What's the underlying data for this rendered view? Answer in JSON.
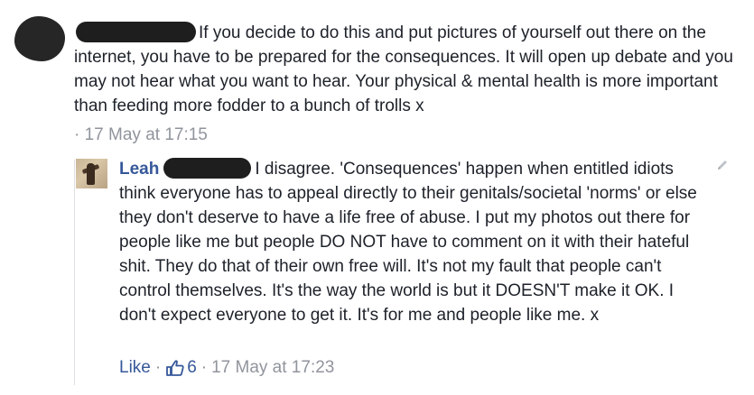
{
  "main_comment": {
    "text": "If you decide to do this and put pictures of yourself out there on the internet, you have to be prepared for the consequences. It will open up debate and you may not hear what you want to hear. Your physical & mental health is more important than feeding more fodder to a bunch of trolls x",
    "separator": "·",
    "timestamp": "17 May at 17:15"
  },
  "reply": {
    "author_first_name": "Leah",
    "text": "I disagree. 'Consequences' happen when entitled idiots think everyone has to appeal directly to their genitals/societal 'norms' or else they don't deserve to have a life free of abuse. I put my photos out there for people like me but people DO NOT have to comment on it with their hateful shit. They do that of their own free will. It's not my fault that people can't control themselves. It's the way the world is but it DOESN'T make it OK. I don't expect everyone to get it. It's for me and people like me. x",
    "like_label": "Like",
    "separator": "·",
    "like_count": "6",
    "timestamp": "17 May at 17:23"
  },
  "colors": {
    "link": "#365899",
    "meta": "#90949c",
    "text": "#1d2129"
  },
  "icons": {
    "edit": "pencil-icon",
    "like": "thumbs-up-icon"
  }
}
